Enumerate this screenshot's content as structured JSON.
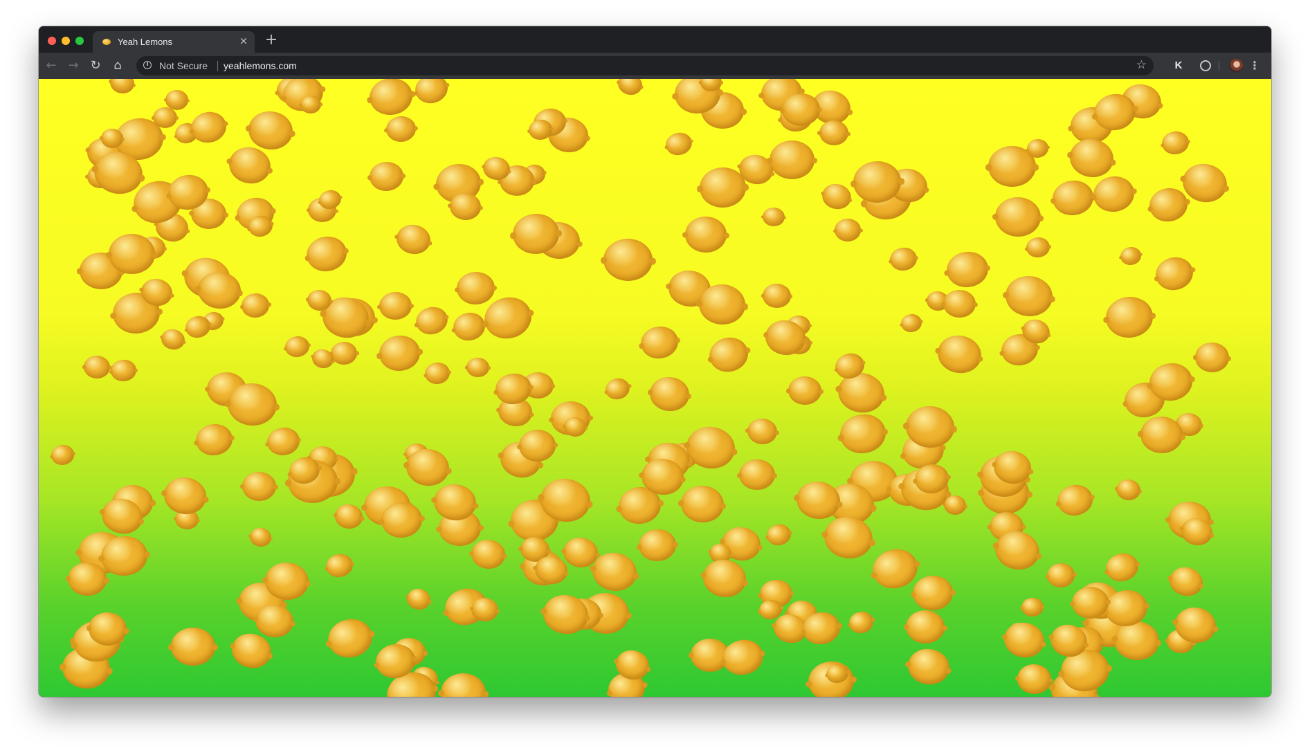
{
  "browser": {
    "tab": {
      "title": "Yeah Lemons",
      "close_glyph": "×",
      "favicon_icon": "lemon-icon"
    },
    "new_tab_glyph": "+",
    "toolbar": {
      "back_glyph": "←",
      "forward_glyph": "→",
      "reload_glyph": "↻",
      "home_glyph": "⌂",
      "security_label": "Not Secure",
      "security_icon": "info-icon",
      "url": "yeahlemons.com",
      "bookmark_glyph": "☆",
      "extension_k_label": "K",
      "menu_glyph": "⋮"
    }
  },
  "page": {
    "background_colors": [
      "#ffff22",
      "#dff21f",
      "#2ec832"
    ],
    "decoration": "lemons"
  }
}
